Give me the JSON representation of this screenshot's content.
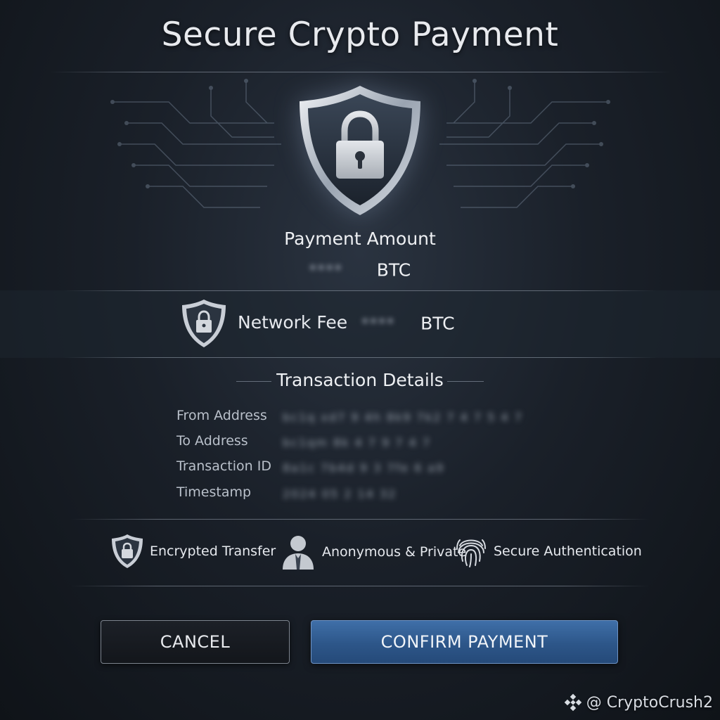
{
  "header": {
    "title": "Secure Crypto Payment"
  },
  "payment": {
    "amount_label": "Payment Amount",
    "amount_value": "****",
    "amount_unit": "BTC"
  },
  "fee": {
    "label": "Network Fee",
    "value": "****",
    "unit": "BTC"
  },
  "details": {
    "title": "Transaction Details",
    "rows": [
      {
        "label": "From Address",
        "value": "bc1q xd7 9 4h 8k9 7k2 7 4 7 5 4 7"
      },
      {
        "label": "To Address",
        "value": "bc1qm 8k 4 7 9 7 4 7"
      },
      {
        "label": "Transaction ID",
        "value": "8a1c 7b4d 9 3 7fe 6 a9"
      },
      {
        "label": "Timestamp",
        "value": "2024 05 2 14 32"
      }
    ]
  },
  "features": [
    {
      "label": "Encrypted Transfer",
      "icon": "shield-lock-icon"
    },
    {
      "label": "Anonymous & Private",
      "icon": "user-icon"
    },
    {
      "label": "Secure Authentication",
      "icon": "fingerprint-icon"
    }
  ],
  "actions": {
    "cancel_label": "CANCEL",
    "confirm_label": "CONFIRM PAYMENT"
  },
  "watermark": {
    "text": "@ CryptoCrush2",
    "icon": "binance-logo-icon"
  },
  "colors": {
    "background": "#1a2029",
    "confirm_button": "#2d5689",
    "cancel_border": "#7d848e",
    "text": "#e6e9ee"
  }
}
